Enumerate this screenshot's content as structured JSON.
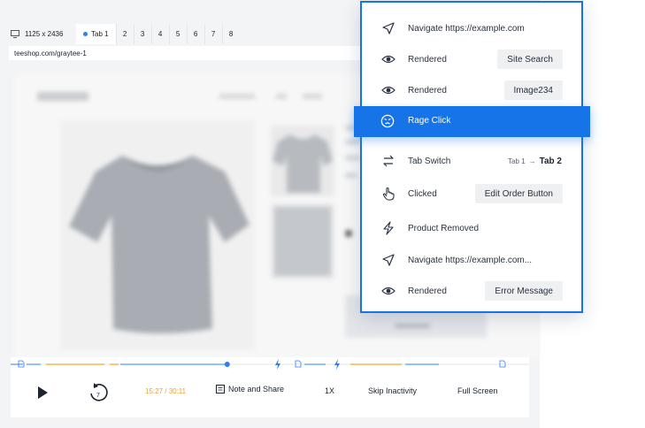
{
  "viewport": {
    "size": "1125 x 2436"
  },
  "tabs": [
    {
      "label": "Tab 1",
      "active": true
    },
    {
      "label": "2"
    },
    {
      "label": "3"
    },
    {
      "label": "4"
    },
    {
      "label": "5"
    },
    {
      "label": "6"
    },
    {
      "label": "7"
    },
    {
      "label": "8"
    }
  ],
  "url": "teeshop.com/graytee-1",
  "player": {
    "time": "15:27 / 30:11",
    "note_label": "Note and Share",
    "speed_label": "1X",
    "skip_label": "Skip Inactivity",
    "fullscreen_label": "Full Screen",
    "progress_fraction": 0.51,
    "rewind_seconds": "7"
  },
  "events": [
    {
      "icon": "navigate-icon",
      "label": "Navigate https://example.com"
    },
    {
      "icon": "eye-icon",
      "label": "Rendered",
      "tag": "Site Search"
    },
    {
      "icon": "eye-icon",
      "label": "Rendered",
      "tag": "Image234"
    },
    {
      "icon": "rage-face-icon",
      "label": "Rage Click",
      "highlighted": true
    },
    {
      "icon": "swap-icon",
      "label": "Tab Switch",
      "from": "Tab 1",
      "to": "Tab 2"
    },
    {
      "icon": "pointer-hand-icon",
      "label": "Clicked",
      "tag": "Edit Order Button"
    },
    {
      "icon": "lightning-icon",
      "label": "Product Removed"
    },
    {
      "icon": "navigate-icon",
      "label": "Navigate https://example.com..."
    },
    {
      "icon": "eye-icon",
      "label": "Rendered",
      "tag": "Error Message"
    }
  ],
  "colors": {
    "accent": "#1673e8",
    "time": "#f0a030",
    "timeline_orange": "#f5b64a"
  }
}
